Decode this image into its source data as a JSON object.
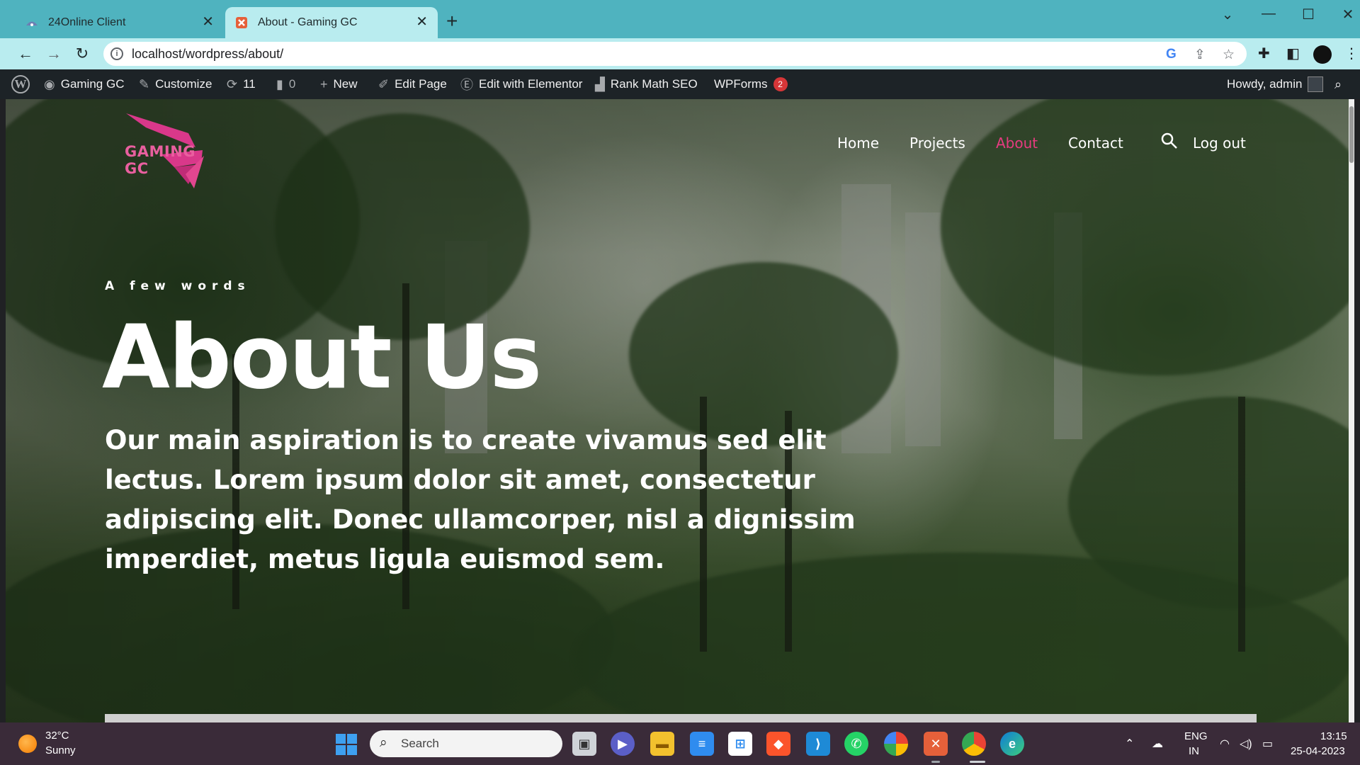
{
  "browser": {
    "tabs": [
      {
        "title": "24Online Client",
        "icon": "network-icon"
      },
      {
        "title": "About - Gaming GC",
        "icon": "elementor-icon",
        "active": true
      }
    ],
    "url": "localhost/wordpress/about/"
  },
  "admin_bar": {
    "site_name": "Gaming GC",
    "customize": "Customize",
    "updates_count": "11",
    "comments_count": "0",
    "new": "New",
    "edit_page": "Edit Page",
    "edit_elementor": "Edit with Elementor",
    "rank_math": "Rank Math SEO",
    "wpforms": "WPForms",
    "wpforms_badge": "2",
    "howdy": "Howdy, admin"
  },
  "site": {
    "logo_text": "GAMING GC",
    "nav": [
      "Home",
      "Projects",
      "About",
      "Contact"
    ],
    "nav_active": "About",
    "logout": "Log out",
    "accent_color": "#e63b80"
  },
  "hero": {
    "eyebrow": "A few words",
    "title": "About Us",
    "text": "Our main aspiration is to create vivamus sed elit lectus. Lorem ipsum dolor sit amet, consectetur adipiscing elit. Donec ullamcorper, nisl a dignissim imperdiet, metus ligula euismod sem."
  },
  "taskbar": {
    "weather_temp": "32°C",
    "weather_cond": "Sunny",
    "search_placeholder": "Search",
    "lang_line1": "ENG",
    "lang_line2": "IN",
    "time": "13:15",
    "date": "25-04-2023"
  }
}
